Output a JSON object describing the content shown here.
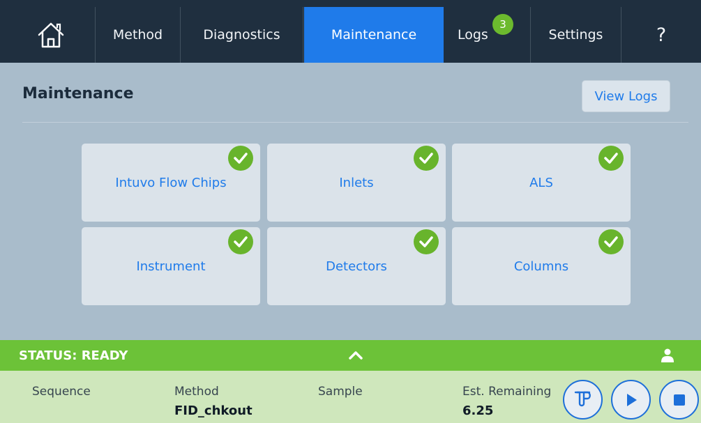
{
  "nav": {
    "home_icon": "home-icon",
    "tabs": [
      {
        "label": "Method"
      },
      {
        "label": "Diagnostics"
      },
      {
        "label": "Maintenance",
        "active": true
      },
      {
        "label": "Logs",
        "badge": "3"
      },
      {
        "label": "Settings"
      }
    ],
    "help_label": "?",
    "active_color": "#1f7bea",
    "badge_color": "#6cba2e"
  },
  "header": {
    "title": "Maintenance",
    "view_logs_label": "View Logs"
  },
  "tiles": [
    {
      "label": "Intuvo Flow Chips",
      "status_icon": "check-circle-icon"
    },
    {
      "label": "Inlets",
      "status_icon": "check-circle-icon"
    },
    {
      "label": "ALS",
      "status_icon": "check-circle-icon"
    },
    {
      "label": "Instrument",
      "status_icon": "check-circle-icon"
    },
    {
      "label": "Detectors",
      "status_icon": "check-circle-icon"
    },
    {
      "label": "Columns",
      "status_icon": "check-circle-icon"
    }
  ],
  "status": {
    "text": "STATUS: READY",
    "color": "#6cc238",
    "chevron_icon": "chevron-up-icon",
    "user_icon": "user-icon"
  },
  "run_info": {
    "sequence_label": "Sequence",
    "method_label": "Method",
    "method_value": "FID_chkout",
    "sample_label": "Sample",
    "remaining_label": "Est. Remaining",
    "remaining_value": "6.25"
  },
  "controls": [
    {
      "name": "prep-run-icon"
    },
    {
      "name": "play-icon"
    },
    {
      "name": "stop-icon"
    }
  ]
}
